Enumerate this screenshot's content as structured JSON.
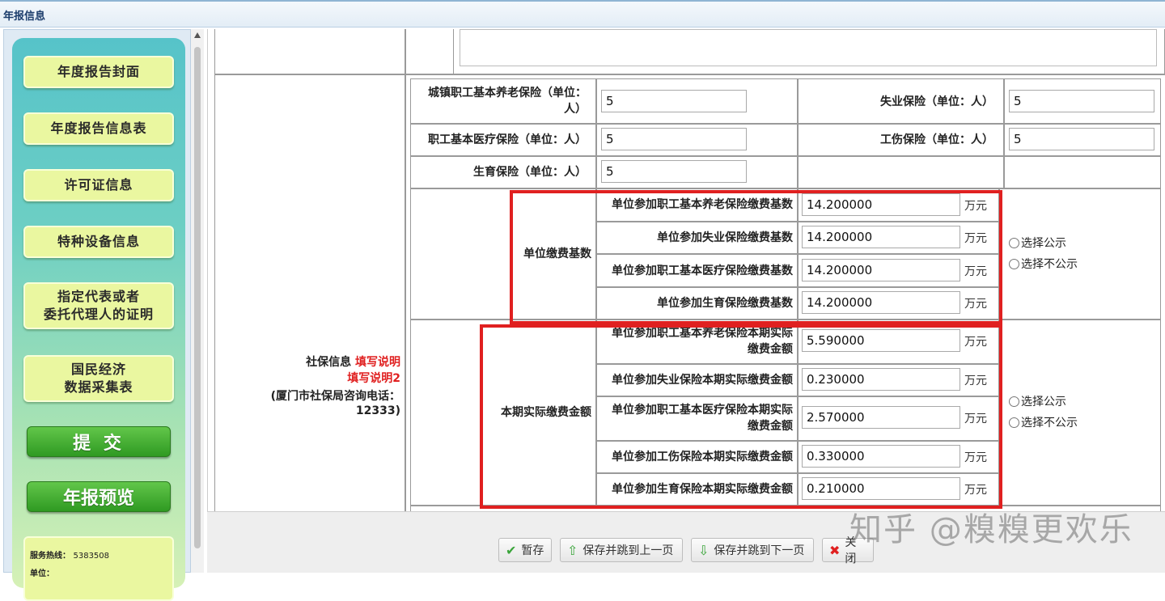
{
  "window": {
    "title": "年报信息"
  },
  "sidebar": {
    "items": [
      {
        "label": "年度报告封面"
      },
      {
        "label": "年度报告信息表"
      },
      {
        "label": "许可证信息"
      },
      {
        "label": "特种设备信息"
      },
      {
        "label_line1": "指定代表或者",
        "label_line2": "委托代理人的证明"
      },
      {
        "label_line1": "国民经济",
        "label_line2": "数据采集表"
      }
    ],
    "submit_label": "提 交",
    "preview_label": "年报预览",
    "hotline_label": "服务热线：",
    "hotline_value": "5383508",
    "unit_label": "单位："
  },
  "section": {
    "label": "社保信息",
    "help1": "填写说明",
    "help2": "填写说明2",
    "phone_note_line1": "(厦门市社保局咨询电话：",
    "phone_note_line2": "12333)"
  },
  "counts": {
    "pension_label_line1": "城镇职工基本养老保险（单位：",
    "pension_label_line2": "人）",
    "pension_value": "5",
    "unemployment_label": "失业保险（单位：人）",
    "unemployment_value": "5",
    "medical_label": "职工基本医疗保险（单位：人）",
    "medical_value": "5",
    "injury_label": "工伤保险（单位：人）",
    "injury_value": "5",
    "maternity_label": "生育保险（单位：人）",
    "maternity_value": "5"
  },
  "base": {
    "group_label": "单位缴费基数",
    "rows": [
      {
        "label": "单位参加职工基本养老保险缴费基数",
        "value": "14.200000",
        "unit": "万元"
      },
      {
        "label": "单位参加失业保险缴费基数",
        "value": "14.200000",
        "unit": "万元"
      },
      {
        "label": "单位参加职工基本医疗保险缴费基数",
        "value": "14.200000",
        "unit": "万元"
      },
      {
        "label": "单位参加生育保险缴费基数",
        "value": "14.200000",
        "unit": "万元"
      }
    ],
    "publish": "选择公示",
    "not_publish": "选择不公示"
  },
  "paid": {
    "group_label": "本期实际缴费金额",
    "rows": [
      {
        "label_line1": "单位参加职工基本养老保险本期实际",
        "label_line2": "缴费金额",
        "value": "5.590000",
        "unit": "万元"
      },
      {
        "label": "单位参加失业保险本期实际缴费金额",
        "value": "0.230000",
        "unit": "万元"
      },
      {
        "label_line1": "单位参加职工基本医疗保险本期实际",
        "label_line2": "缴费金额",
        "value": "2.570000",
        "unit": "万元"
      },
      {
        "label": "单位参加工伤保险本期实际缴费金额",
        "value": "0.330000",
        "unit": "万元"
      },
      {
        "label": "单位参加生育保险本期实际缴费金额",
        "value": "0.210000",
        "unit": "万元"
      }
    ],
    "publish": "选择公示",
    "not_publish": "选择不公示"
  },
  "footer": {
    "save": "暂存",
    "save_prev": "保存并跳到上一页",
    "save_next": "保存并跳到下一页",
    "close": "关闭"
  },
  "watermark": "知乎 @糗糗更欢乐"
}
